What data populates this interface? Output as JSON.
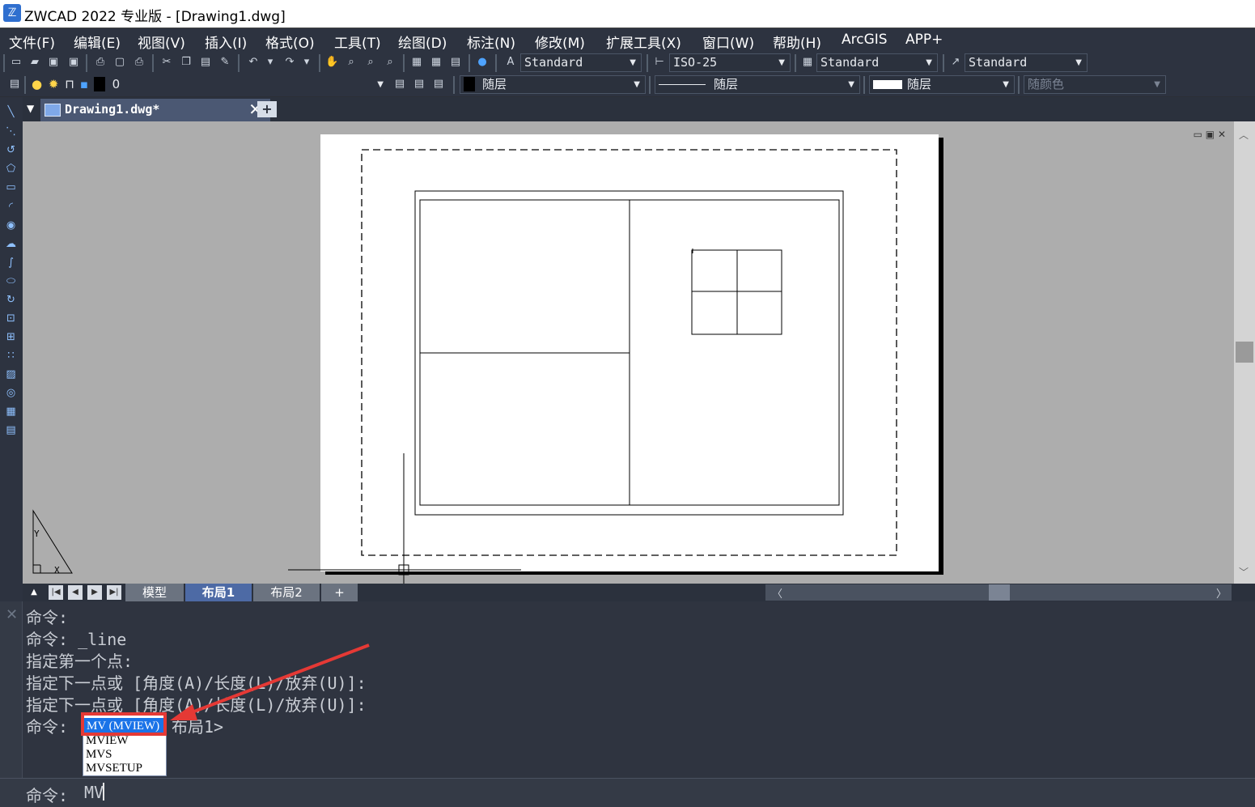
{
  "window": {
    "title": "ZWCAD 2022 专业版 - [Drawing1.dwg]",
    "logo_glyph": "ℤ"
  },
  "menu": {
    "items": [
      "文件(F)",
      "编辑(E)",
      "视图(V)",
      "插入(I)",
      "格式(O)",
      "工具(T)",
      "绘图(D)",
      "标注(N)",
      "修改(M)",
      "扩展工具(X)",
      "窗口(W)",
      "帮助(H)",
      "ArcGIS",
      "APP+"
    ]
  },
  "toolbar": {
    "text_style": "Standard",
    "dim_style": "ISO-25",
    "table_style": "Standard",
    "multileader_style": "Standard",
    "layer_name": "0",
    "color": "随层",
    "linetype": "随层",
    "lineweight": "随层",
    "plot_style": "随颜色"
  },
  "document": {
    "tab_label": "Drawing1.dwg*",
    "close_glyph": "✕",
    "new_tab_glyph": "+"
  },
  "viewport": {
    "controls": "▭ ▣ ✕",
    "background_color": "#adadad",
    "paper_color": "#ffffff"
  },
  "layout_tabs": {
    "tabs": [
      "模型",
      "布局1",
      "布局2",
      "+"
    ],
    "active": "布局1",
    "nav_glyphs": [
      "▲",
      "|◀",
      "◀",
      "▶",
      "▶|"
    ]
  },
  "command": {
    "history": [
      "命令:",
      "命令: _line",
      "指定第一个点:",
      "指定下一点或 [角度(A)/长度(L)/放弃(U)]:",
      "指定下一点或 [角度(A)/长度(L)/放弃(U)]:"
    ],
    "last_prompt": "命令:",
    "suggest_tail": "布局1>",
    "input_prompt": "命令:",
    "input_value": "MV",
    "autocomplete": [
      "MV (MVIEW)",
      "MVIEW",
      "MVS",
      "MVSETUP"
    ],
    "autocomplete_selected": "MV (MVIEW)",
    "annotation_color": "#e53935"
  }
}
